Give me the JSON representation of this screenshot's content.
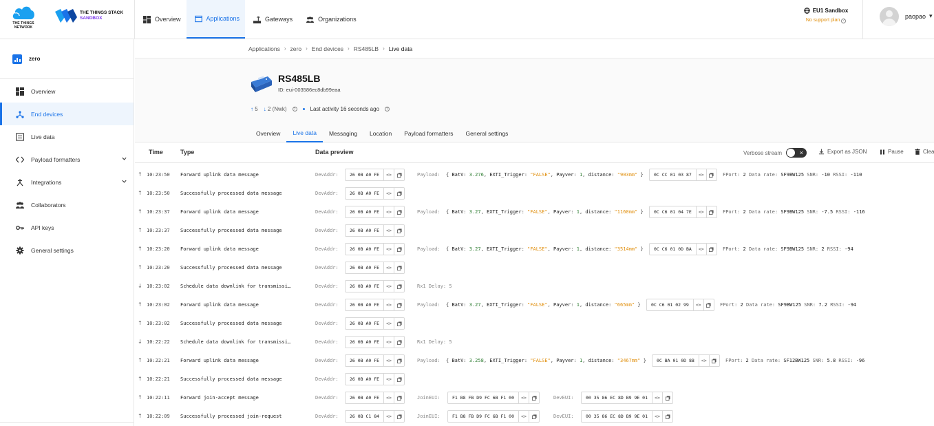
{
  "brand": {
    "ttn_lines": [
      "THE THINGS",
      "NETWORK"
    ],
    "tts_line1": "THE THINGS STACK",
    "tts_line2": "SANDBOX"
  },
  "nav": {
    "items": [
      {
        "label": "Overview",
        "icon": "dashboard-icon"
      },
      {
        "label": "Applications",
        "icon": "application-icon",
        "active": true
      },
      {
        "label": "Gateways",
        "icon": "gateway-icon"
      },
      {
        "label": "Organizations",
        "icon": "organization-icon"
      }
    ]
  },
  "cluster": {
    "name": "EU1 Sandbox",
    "plan": "No support plan"
  },
  "user": {
    "name": "paopao"
  },
  "sidebar": {
    "app_name": "zero",
    "items": [
      {
        "label": "Overview",
        "icon": "dashboard-icon"
      },
      {
        "label": "End devices",
        "icon": "end-device-icon",
        "active": true
      },
      {
        "label": "Live data",
        "icon": "live-data-icon"
      },
      {
        "label": "Payload formatters",
        "icon": "code-icon",
        "chevron": true
      },
      {
        "label": "Integrations",
        "icon": "integration-icon",
        "chevron": true
      },
      {
        "label": "Collaborators",
        "icon": "collaborators-icon"
      },
      {
        "label": "API keys",
        "icon": "key-icon"
      },
      {
        "label": "General settings",
        "icon": "gear-icon"
      }
    ]
  },
  "breadcrumb": [
    "Applications",
    "zero",
    "End devices",
    "RS485LB",
    "Live data"
  ],
  "device": {
    "name": "RS485LB",
    "id": "ID: eui-003586ec8db99eaa",
    "uplinks": "5",
    "downlinks": "2",
    "downlinks_note": "(Nwk)",
    "last_activity": "Last activity",
    "last_activity_ago": "16 seconds ago"
  },
  "tabs": [
    "Overview",
    "Live data",
    "Messaging",
    "Location",
    "Payload formatters",
    "General settings"
  ],
  "active_tab": "Live data",
  "table": {
    "col_time": "Time",
    "col_type": "Type",
    "col_preview": "Data preview",
    "verbose_label": "Verbose stream",
    "export_label": "Export as JSON",
    "pause_label": "Pause",
    "clear_label": "Clear"
  },
  "labels": {
    "devaddr": "DevAddr:",
    "payload": "Payload:",
    "joineui": "JoinEUI:",
    "deveui": "DevEUI:",
    "fport": "FPort:",
    "datarate": "Data rate:",
    "snr": "SNR:",
    "rssi": "RSSI:"
  },
  "rows": [
    {
      "dir": "up",
      "time": "10:23:50",
      "type": "Forward uplink data message",
      "devaddr": "26 0B A0 FE",
      "kind": "uplink",
      "batv": "3.276",
      "exti": "\"FALSE\"",
      "payver": "1",
      "distance": "\"903mm\"",
      "raw": "0C CC 01 03 87",
      "fport": "2",
      "datarate": "SF9BW125",
      "snr": "-10",
      "rssi": "-110"
    },
    {
      "dir": "up",
      "time": "10:23:50",
      "type": "Successfully processed data message",
      "devaddr": "26 0B A0 FE",
      "kind": "plain"
    },
    {
      "dir": "up",
      "time": "10:23:37",
      "type": "Forward uplink data message",
      "devaddr": "26 0B A0 FE",
      "kind": "uplink",
      "batv": "3.27",
      "exti": "\"FALSE\"",
      "payver": "1",
      "distance": "\"1160mm\"",
      "raw": "0C C6 01 04 7E",
      "fport": "2",
      "datarate": "SF9BW125",
      "snr": "-7.5",
      "rssi": "-116"
    },
    {
      "dir": "up",
      "time": "10:23:37",
      "type": "Successfully processed data message",
      "devaddr": "26 0B A0 FE",
      "kind": "plain"
    },
    {
      "dir": "up",
      "time": "10:23:20",
      "type": "Forward uplink data message",
      "devaddr": "26 0B A0 FE",
      "kind": "uplink",
      "batv": "3.27",
      "exti": "\"FALSE\"",
      "payver": "1",
      "distance": "\"3514mm\"",
      "raw": "0C C6 01 0D BA",
      "fport": "2",
      "datarate": "SF9BW125",
      "snr": "2",
      "rssi": "-94"
    },
    {
      "dir": "up",
      "time": "10:23:20",
      "type": "Successfully processed data message",
      "devaddr": "26 0B A0 FE",
      "kind": "plain"
    },
    {
      "dir": "down",
      "time": "10:23:02",
      "type": "Schedule data downlink for transmissi…",
      "devaddr": "26 0B A0 FE",
      "kind": "rx1",
      "rx1": "Rx1 Delay: 5"
    },
    {
      "dir": "up",
      "time": "10:23:02",
      "type": "Forward uplink data message",
      "devaddr": "26 0B A0 FE",
      "kind": "uplink",
      "batv": "3.27",
      "exti": "\"FALSE\"",
      "payver": "1",
      "distance": "\"665mm\"",
      "raw": "0C C6 01 02 99",
      "fport": "2",
      "datarate": "SF9BW125",
      "snr": "7.2",
      "rssi": "-94"
    },
    {
      "dir": "up",
      "time": "10:23:02",
      "type": "Successfully processed data message",
      "devaddr": "26 0B A0 FE",
      "kind": "plain"
    },
    {
      "dir": "down",
      "time": "10:22:22",
      "type": "Schedule data downlink for transmissi…",
      "devaddr": "26 0B A0 FE",
      "kind": "rx1",
      "rx1": "Rx1 Delay: 5"
    },
    {
      "dir": "up",
      "time": "10:22:21",
      "type": "Forward uplink data message",
      "devaddr": "26 0B A0 FE",
      "kind": "uplink",
      "batv": "3.258",
      "exti": "\"FALSE\"",
      "payver": "1",
      "distance": "\"3467mm\"",
      "raw": "0C BA 01 0D 8B",
      "fport": "2",
      "datarate": "SF12BW125",
      "snr": "5.8",
      "rssi": "-96"
    },
    {
      "dir": "up",
      "time": "10:22:21",
      "type": "Successfully processed data message",
      "devaddr": "26 0B A0 FE",
      "kind": "plain"
    },
    {
      "dir": "up",
      "time": "10:22:11",
      "type": "Forward join-accept message",
      "devaddr": "26 0B A0 FE",
      "kind": "join",
      "joineui": "F1 B8 FB D9 FC 6B F1 00",
      "deveui": "00 35 86 EC 8D B9 9E 01"
    },
    {
      "dir": "up",
      "time": "10:22:09",
      "type": "Successfully processed join-request",
      "devaddr": "26 0B C1 84",
      "kind": "join",
      "joineui": "F1 B8 FB D9 FC 6B F1 00",
      "deveui": "00 35 86 EC 8D B9 9E 01"
    }
  ]
}
